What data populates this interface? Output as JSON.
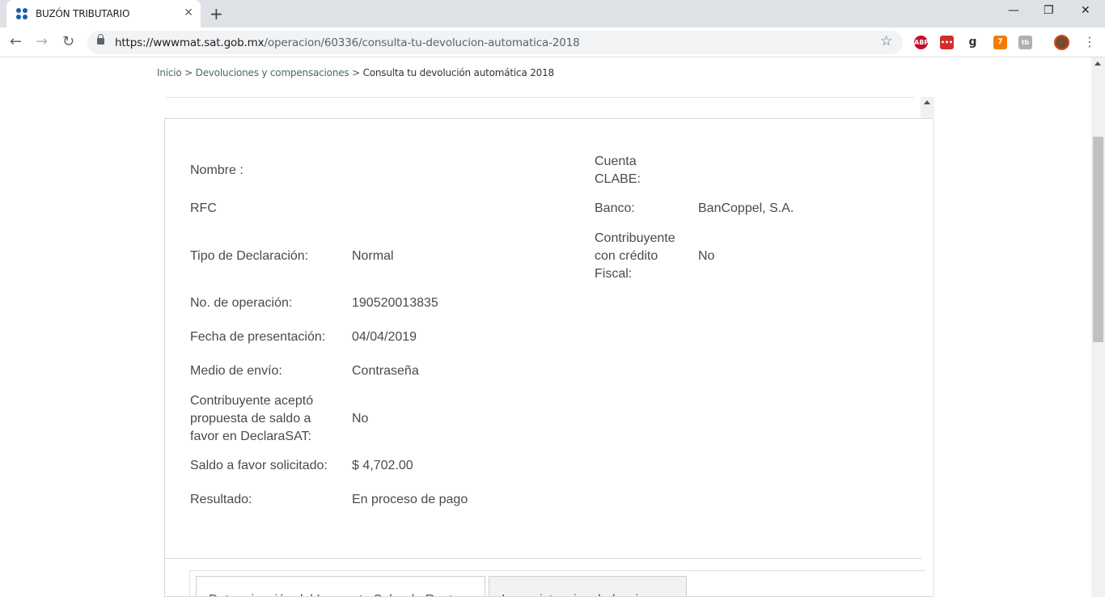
{
  "browser": {
    "tab_title": "BUZÓN TRIBUTARIO",
    "url_host": "https://wwwmat.sat.gob.mx",
    "url_path": "/operacion/60336/consulta-tu-devolucion-automatica-2018",
    "extensions": [
      {
        "name": "adblock-plus-icon",
        "label": "ABP",
        "color": "#c70d2c"
      },
      {
        "name": "lastpass-icon",
        "label": "•••",
        "color": "#d32d27"
      },
      {
        "name": "grammarly-icon",
        "label": "g",
        "color": "#ffffff"
      },
      {
        "name": "rss-icon",
        "label": "7",
        "color": "#f57c00"
      },
      {
        "name": "tb-icon",
        "label": "tb",
        "color": "#b0b0b0"
      }
    ]
  },
  "breadcrumb": {
    "home": "Inicio",
    "sep1": " > ",
    "section": "Devoluciones y compensaciones",
    "sep2": " > ",
    "current": "Consulta tu devolución automática 2018"
  },
  "details_left": [
    {
      "label": "Nombre :",
      "value": ""
    },
    {
      "label": "RFC",
      "value": ""
    },
    {
      "label": "Tipo de Declaración:",
      "value": "Normal"
    },
    {
      "label": "No. de operación:",
      "value": "190520013835"
    },
    {
      "label": "Fecha de presentación:",
      "value": "04/04/2019"
    },
    {
      "label": "Medio de envío:",
      "value": "Contraseña"
    },
    {
      "label": "Contribuyente aceptó propuesta de saldo a favor en DeclaraSAT:",
      "value": "No"
    },
    {
      "label": "Saldo a favor solicitado:",
      "value": "$ 4,702.00"
    },
    {
      "label": "Resultado:",
      "value": "En proceso de pago"
    }
  ],
  "details_right": [
    {
      "label": "Cuenta CLABE:",
      "value": ""
    },
    {
      "label": "Banco:",
      "value": "BanCoppel, S.A."
    },
    {
      "label": "Contribuyente con crédito Fiscal:",
      "value": "No"
    }
  ],
  "tabs": [
    {
      "label": "Determinación del Impuesto Sobre la Renta"
    },
    {
      "label": "Inconsistencias deducciones"
    }
  ]
}
